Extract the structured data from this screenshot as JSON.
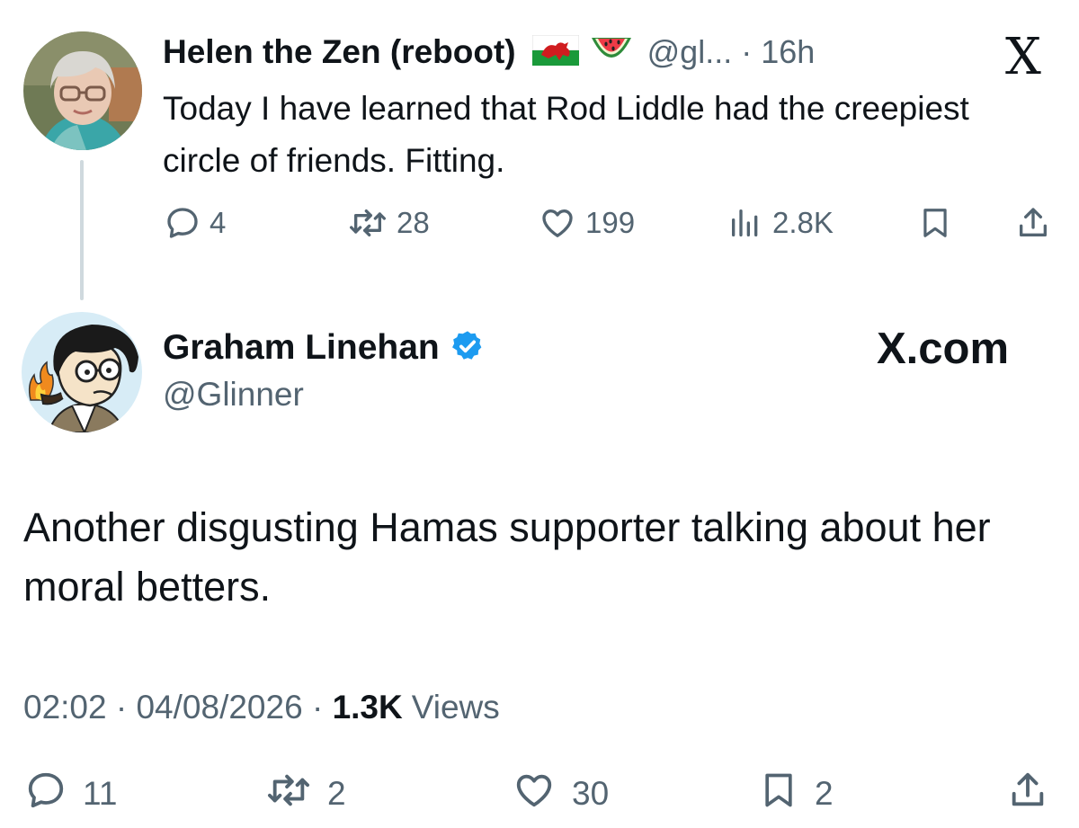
{
  "tweet1": {
    "display_name": "Helen the Zen (reboot)",
    "handle_time": "@gl... · 16h",
    "text": "Today I have learned that Rod Liddle had the creepiest circle of friends.  Fitting.",
    "replies": "4",
    "reposts": "28",
    "likes": "199",
    "views": "2.8K",
    "logo": "X"
  },
  "tweet2": {
    "display_name": "Graham Linehan",
    "handle": "@Glinner",
    "site": "X.com",
    "text": "Another disgusting Hamas supporter talking about her moral betters.",
    "time": "02:02",
    "date": "04/08/2026",
    "sep": " · ",
    "views_count": "1.3K",
    "views_label": "Views",
    "replies": "11",
    "reposts": "2",
    "likes": "30",
    "bookmarks": "2"
  },
  "icons": {
    "reply": "reply-icon",
    "repost": "repost-icon",
    "like": "heart-icon",
    "views": "views-icon",
    "bookmark": "bookmark-icon",
    "share": "share-icon",
    "verified": "verified-badge-icon"
  },
  "colors": {
    "text": "#0f1419",
    "secondary": "#536471",
    "verified": "#1d9bf0",
    "thread_line": "#cfd9de"
  }
}
